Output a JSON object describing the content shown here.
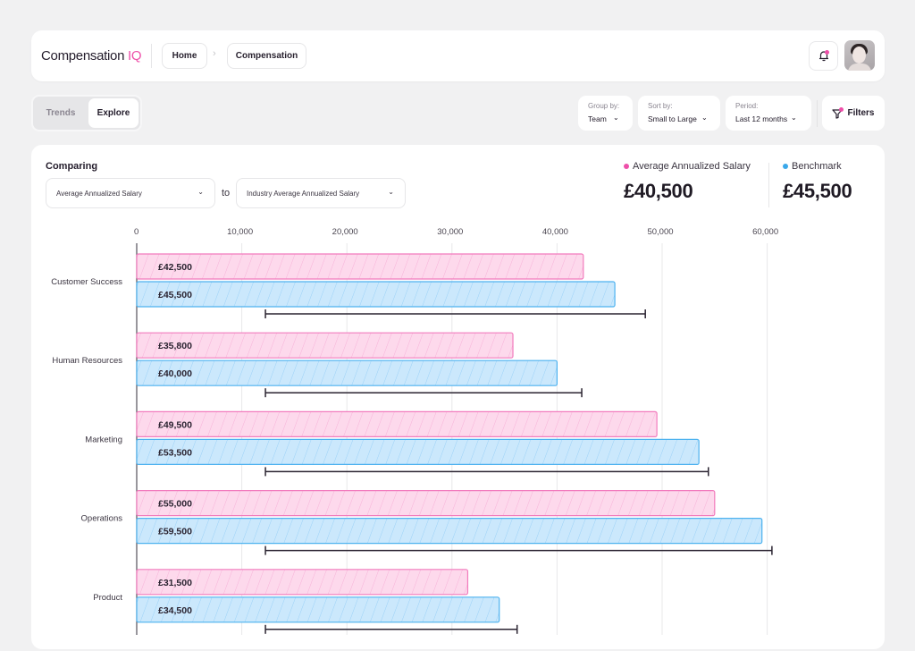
{
  "app": {
    "logo_text": "Compensation",
    "logo_accent": "IQ"
  },
  "breadcrumb": {
    "home": "Home",
    "separator": "›",
    "current": "Compensation"
  },
  "header": {
    "notification_icon": "bell-icon",
    "has_unread": true,
    "avatar": "user-avatar"
  },
  "view_tabs": [
    {
      "label": "Trends",
      "active": false
    },
    {
      "label": "Explore",
      "active": true
    }
  ],
  "controls": {
    "group_by": {
      "label": "Group by:",
      "value": "Team"
    },
    "sort_by": {
      "label": "Sort by:",
      "value": "Small to Large"
    },
    "period": {
      "label": "Period:",
      "value": "Last 12 months"
    },
    "filters_label": "Filters"
  },
  "comparison": {
    "title": "Comparing",
    "metric_a": "Average Annualized Salary",
    "connector": "to",
    "metric_b": "Industry Average Annualized Salary"
  },
  "kpis": {
    "average": {
      "label": "Average Annualized Salary",
      "value": "£40,500",
      "color": "#ee4fa9"
    },
    "benchmark": {
      "label": "Benchmark",
      "value": "£45,500",
      "color": "#3aa8ea"
    }
  },
  "colors": {
    "accent": "#ee4fa9",
    "pink_fill": "#fdd9ec",
    "pink_stroke": "#f27bbd",
    "blue_fill": "#cbe8fc",
    "blue_stroke": "#4db2ef"
  },
  "chart_data": {
    "type": "bar",
    "orientation": "horizontal",
    "title": "Comparing Average Annualized Salary to Industry Average Annualized Salary",
    "xlabel": "",
    "ylabel": "",
    "xlim": [
      0,
      65000
    ],
    "x_ticks": [
      0,
      10000,
      20000,
      30000,
      40000,
      50000,
      60000
    ],
    "x_tick_labels": [
      "0",
      "10,000",
      "20,000",
      "30,000",
      "40,000",
      "50,000",
      "60,000"
    ],
    "grid": true,
    "categories": [
      "Customer Success",
      "Human Resources",
      "Marketing",
      "Operations",
      "Product"
    ],
    "series": [
      {
        "name": "Average Annualized Salary",
        "values": [
          42500,
          35800,
          49500,
          55000,
          31500
        ],
        "labels": [
          "£42,500",
          "£35,800",
          "£49,500",
          "£55,000",
          "£31,500"
        ]
      },
      {
        "name": "Benchmark",
        "values": [
          45500,
          40000,
          53500,
          59500,
          34500
        ],
        "labels": [
          "£45,500",
          "£40,000",
          "£53,500",
          "£59,500",
          "£34,500"
        ]
      }
    ],
    "ranges": [
      {
        "category": "Customer Success",
        "min": 12250,
        "max": 48400
      },
      {
        "category": "Human Resources",
        "min": 12250,
        "max": 42350
      },
      {
        "category": "Marketing",
        "min": 12250,
        "max": 54400
      },
      {
        "category": "Operations",
        "min": 12250,
        "max": 60450
      },
      {
        "category": "Product",
        "min": 12250,
        "max": 36200
      }
    ]
  }
}
